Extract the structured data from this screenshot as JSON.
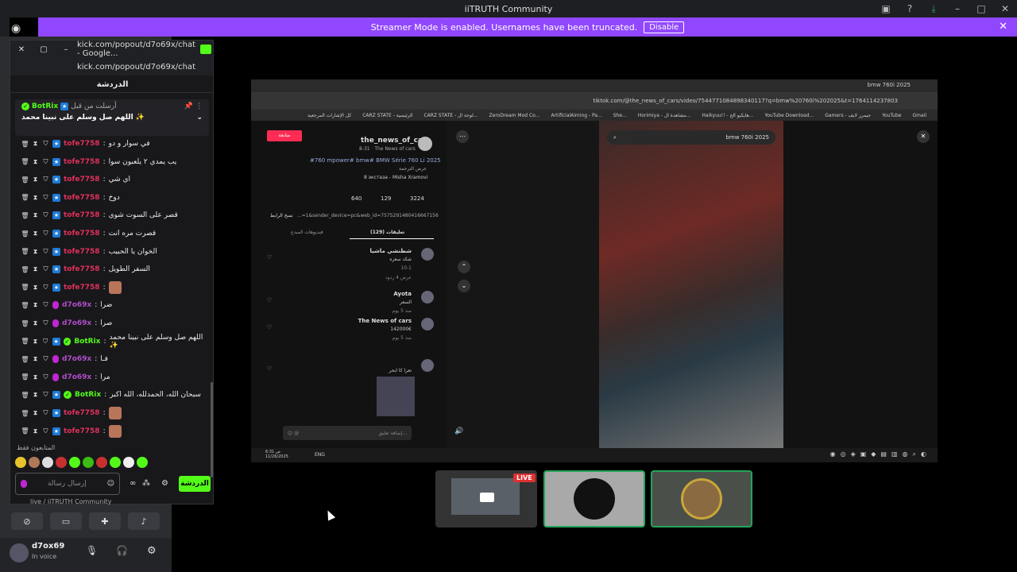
{
  "window": {
    "title": "iiTRUTH Community"
  },
  "streamer_banner": {
    "text": "Streamer Mode is enabled. Usernames have been truncated.",
    "button": "Disable"
  },
  "popup": {
    "title": "kick.com/popout/d7o69x/chat - Google...",
    "url": "kick.com/popout/d7o69x/chat",
    "chat_heading": "الدردشة",
    "pinned": {
      "by": "أرسلت من قبل",
      "user": "BotRix",
      "text": "اللهم صل وسلم على نبينا محمد ✨"
    },
    "messages": [
      {
        "user": "tofe7758",
        "color": "red",
        "text": "في سوار و دو"
      },
      {
        "user": "tofe7758",
        "color": "red",
        "text": "يب يمدي ٢ يلعبون سوا"
      },
      {
        "user": "tofe7758",
        "color": "red",
        "text": "اي شي"
      },
      {
        "user": "tofe7758",
        "color": "red",
        "text": "دوخ"
      },
      {
        "user": "tofe7758",
        "color": "red",
        "text": "قصر على السوت شوي"
      },
      {
        "user": "tofe7758",
        "color": "red",
        "text": "قصرت مره انت"
      },
      {
        "user": "tofe7758",
        "color": "red",
        "text": "الخوان يا الحبيب"
      },
      {
        "user": "tofe7758",
        "color": "red",
        "text": "السفر الطويل"
      },
      {
        "user": "tofe7758",
        "color": "red",
        "text": ""
      },
      {
        "user": "d7o69x",
        "color": "purple",
        "text": "ضرا"
      },
      {
        "user": "d7o69x",
        "color": "purple",
        "text": "صرا"
      },
      {
        "user": "BotRix",
        "color": "green",
        "text": "اللهم صل وسلم على نبينا محمد ✨"
      },
      {
        "user": "d7o69x",
        "color": "purple",
        "text": "فـا"
      },
      {
        "user": "d7o69x",
        "color": "purple",
        "text": "مرا"
      },
      {
        "user": "BotRix",
        "color": "green",
        "text": "سبحان الله، الحمدلله، الله اكبر"
      },
      {
        "user": "tofe7758",
        "color": "red",
        "text": ""
      },
      {
        "user": "tofe7758",
        "color": "red",
        "text": ""
      }
    ],
    "emotes_label": "المتابعون فقط",
    "input_placeholder": "إرسال رسالة",
    "send_label": "الدردشة"
  },
  "sidebar": {
    "server_label": "live / iiTRUTH Community",
    "user": {
      "name": "d7ox69",
      "status": "In voice"
    }
  },
  "screen_share": {
    "url": "tiktok.com/@the_news_of_cars/video/7544771084898340117?q=bmw%20760i%202025&t=1764114237803",
    "tab_title": "bmw 760i 2025",
    "bookmarks": [
      "كل الإشارات المرجعية",
      "CARZ STATE - الرئيسية",
      "CARZ STATE - لوحة ال...",
      "ZeroDream Mod Co...",
      "ArtificialAiming - Pa...",
      "She...",
      "Horimiya - مشاهدة ال...",
      "Haikyuu!! - هايكيو الح...",
      "YouTube Download...",
      "Gamers - جيمرز لايف",
      "YouTube",
      "Gmail"
    ],
    "account": "the_news_of_cars",
    "account_sub": "8-31 · The News of cars",
    "follow_label": "متابعة",
    "caption": "#760 mpower# bmw# BMW Série 760 Li 2025",
    "translate": "عرض الترجمة",
    "music": "8 экстаза - Misha Xramovi",
    "likes": "3224",
    "comments_count": "129",
    "saves": "640",
    "link_text": "...=1&sender_device=pc&web_id=7575291480416667156",
    "copy_link": "نسخ الرابط",
    "tab_comments": "تعليقات (129)",
    "tab_creator": "فيديوهات المبدع",
    "comments": [
      {
        "user": "شطنشي ماشيا",
        "text": "شكد سعره",
        "meta": "10-1",
        "replies": "عرض 4 ردود"
      },
      {
        "user": "Ayota",
        "text": "السعر",
        "meta": "منذ 5 يوم"
      },
      {
        "user": "The News of cars",
        "text": "142000€",
        "meta": "منذ 5 يوم"
      },
      {
        "user": "",
        "text": "تعرا كا ابحر",
        "meta": ""
      }
    ],
    "comment_placeholder": "إضافة تعليق...",
    "search_text": "bmw 760i 2025",
    "clock": {
      "time": "6:31 ص",
      "date": "11/26/2025"
    },
    "lang": "ENG"
  },
  "tiles": {
    "live_badge": "LIVE"
  }
}
